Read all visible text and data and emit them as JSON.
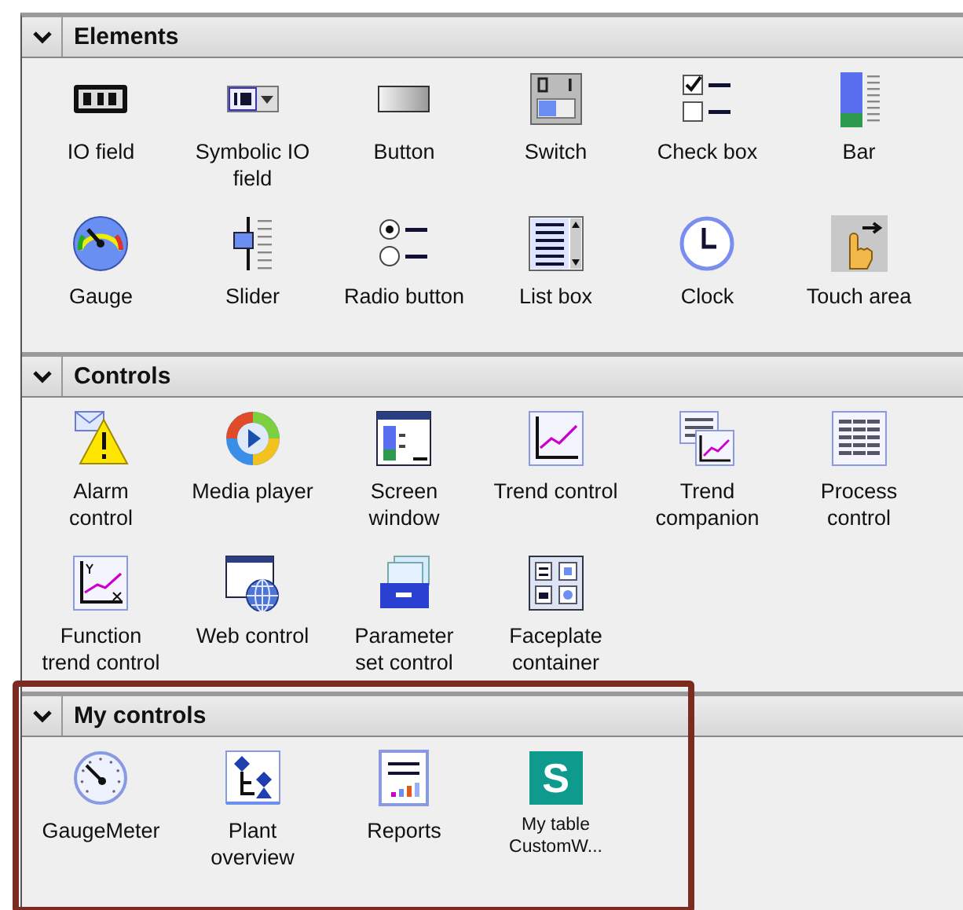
{
  "sections": [
    {
      "title": "Elements",
      "expanded": true,
      "highlighted": false,
      "items": [
        {
          "label": "IO field"
        },
        {
          "label": "Symbolic IO\nfield"
        },
        {
          "label": "Button"
        },
        {
          "label": "Switch"
        },
        {
          "label": "Check box"
        },
        {
          "label": "Bar"
        },
        {
          "label": "Gauge"
        },
        {
          "label": "Slider"
        },
        {
          "label": "Radio button"
        },
        {
          "label": "List box"
        },
        {
          "label": "Clock"
        },
        {
          "label": "Touch area"
        }
      ]
    },
    {
      "title": "Controls",
      "expanded": true,
      "highlighted": false,
      "items": [
        {
          "label": "Alarm\ncontrol"
        },
        {
          "label": "Media player"
        },
        {
          "label": "Screen\nwindow"
        },
        {
          "label": "Trend control"
        },
        {
          "label": "Trend\ncompanion"
        },
        {
          "label": "Process\ncontrol"
        },
        {
          "label": "Function\ntrend control"
        },
        {
          "label": "Web control"
        },
        {
          "label": "Parameter\nset control"
        },
        {
          "label": "Faceplate\ncontainer"
        }
      ]
    },
    {
      "title": "My controls",
      "expanded": true,
      "highlighted": true,
      "items": [
        {
          "label": "GaugeMeter"
        },
        {
          "label": "Plant\noverview"
        },
        {
          "label": "Reports"
        },
        {
          "label": "My table\nCustomW...",
          "small": true,
          "badge": "S"
        }
      ]
    }
  ]
}
